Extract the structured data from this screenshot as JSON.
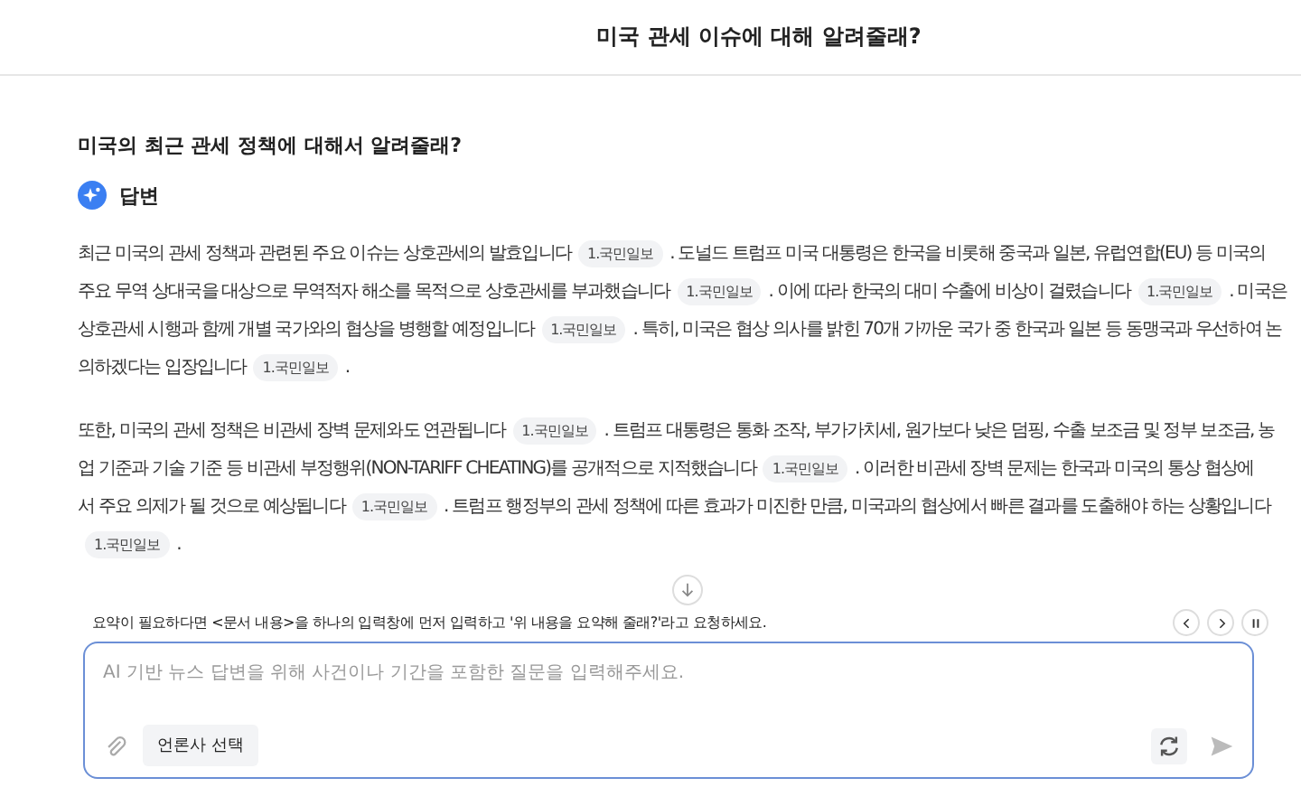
{
  "header": {
    "title": "미국 관세 이슈에 대해 알려줄래?"
  },
  "question": "미국의 최근 관세 정책에 대해서 알려줄래?",
  "answer_label": "답변",
  "paragraphs": [
    {
      "lines": [
        [
          {
            "kind": "text",
            "text": "최근 미국의 관세 정책과 관련된 주요 이슈는 상호관세의 발효입니다"
          },
          {
            "kind": "citation",
            "text": "1.국민일보"
          },
          {
            "kind": "text",
            "text": ". 도널드 트럼프 미국 대통령은 한국을 비롯해 중국과 일본, 유럽연합(EU) 등 미국의"
          }
        ],
        [
          {
            "kind": "text",
            "text": "주요 무역 상대국을 대상으로 무역적자 해소를 목적으로 상호관세를 부과했습니다"
          },
          {
            "kind": "citation",
            "text": "1.국민일보"
          },
          {
            "kind": "text",
            "text": ". 이에 따라 한국의 대미 수출에 비상이 걸렸습니다"
          },
          {
            "kind": "citation",
            "text": "1.국민일보"
          },
          {
            "kind": "text",
            "text": ". 미국은"
          }
        ],
        [
          {
            "kind": "text",
            "text": "상호관세 시행과 함께 개별 국가와의 협상을 병행할 예정입니다"
          },
          {
            "kind": "citation",
            "text": "1.국민일보"
          },
          {
            "kind": "text",
            "text": ". 특히, 미국은 협상 의사를 밝힌 70개 가까운 국가 중 한국과 일본 등 동맹국과 우선하여 논"
          }
        ],
        [
          {
            "kind": "text",
            "text": "의하겠다는 입장입니다"
          },
          {
            "kind": "citation",
            "text": "1.국민일보"
          },
          {
            "kind": "text",
            "text": "."
          }
        ]
      ]
    },
    {
      "lines": [
        [
          {
            "kind": "text",
            "text": "또한, 미국의 관세 정책은 비관세 장벽 문제와도 연관됩니다"
          },
          {
            "kind": "citation",
            "text": "1.국민일보"
          },
          {
            "kind": "text",
            "text": ". 트럼프 대통령은 통화 조작, 부가가치세, 원가보다 낮은 덤핑, 수출 보조금 및 정부 보조금, 농"
          }
        ],
        [
          {
            "kind": "text",
            "text": "업 기준과 기술 기준 등 비관세 부정행위(NON-TARIFF CHEATING)를 공개적으로 지적했습니다"
          },
          {
            "kind": "citation",
            "text": "1.국민일보"
          },
          {
            "kind": "text",
            "text": ". 이러한 비관세 장벽 문제는 한국과 미국의 통상 협상에"
          }
        ],
        [
          {
            "kind": "text",
            "text": "서 주요 의제가 될 것으로 예상됩니다"
          },
          {
            "kind": "citation",
            "text": "1.국민일보"
          },
          {
            "kind": "text",
            "text": ". 트럼프 행정부의 관세 정책에 따른 효과가 미진한 만큼, 미국과의 협상에서 빠른 결과를 도출해야 하는 상황입니다"
          }
        ],
        [
          {
            "kind": "citation",
            "text": "1.국민일보"
          },
          {
            "kind": "text",
            "text": "."
          }
        ]
      ]
    }
  ],
  "tip": "요약이 필요하다면 <문서 내용>을 하나의 입력창에 먼저 입력하고 '위 내용을 요약해 줄래?'라고 요청하세요.",
  "composer": {
    "placeholder": "AI 기반 뉴스 답변을 위해 사건이나 기간을 포함한 질문을 입력해주세요.",
    "publisher_button": "언론사 선택"
  }
}
